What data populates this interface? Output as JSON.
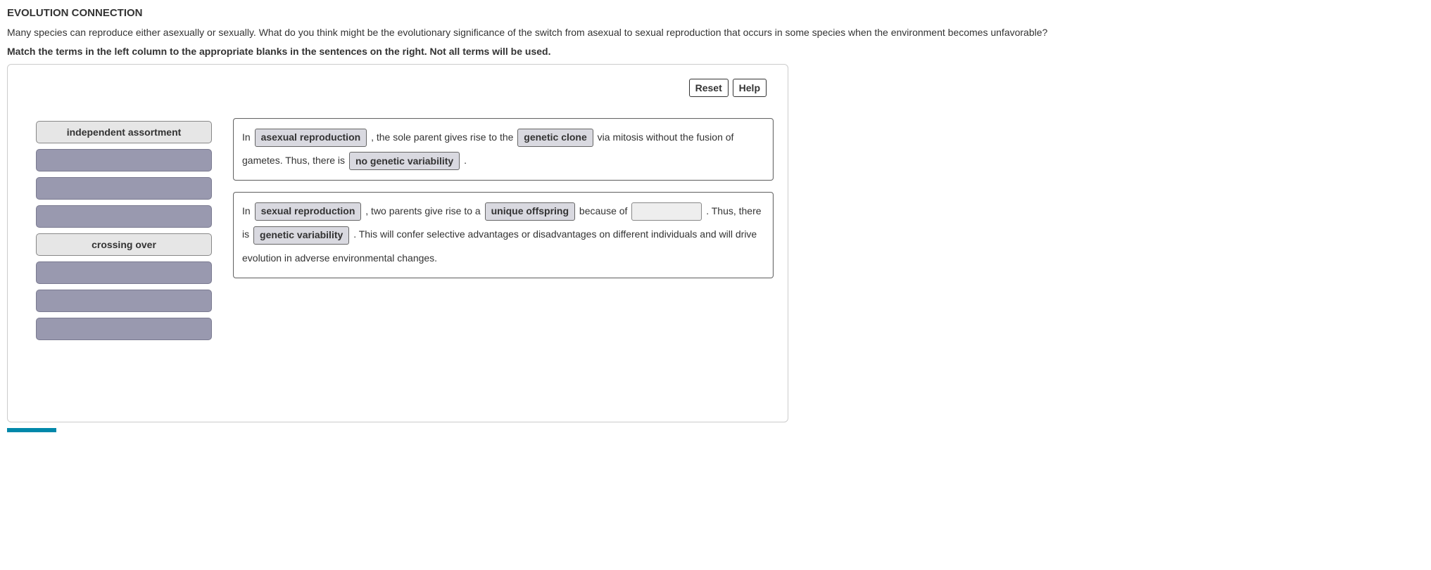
{
  "heading": "EVOLUTION CONNECTION",
  "prompt": "Many species can reproduce either asexually or sexually. What do you think might be the evolutionary significance of the switch from asexual to sexual reproduction that occurs in some species when the environment becomes unfavorable?",
  "instruction": "Match the terms in the left column to the appropriate blanks in the sentences on the right. Not all terms will be used.",
  "controls": {
    "reset": "Reset",
    "help": "Help"
  },
  "terms": [
    {
      "label": "independent assortment",
      "state": "available"
    },
    {
      "label": "",
      "state": "used"
    },
    {
      "label": "",
      "state": "used"
    },
    {
      "label": "",
      "state": "used"
    },
    {
      "label": "crossing over",
      "state": "available"
    },
    {
      "label": "",
      "state": "used"
    },
    {
      "label": "",
      "state": "used"
    },
    {
      "label": "",
      "state": "used"
    }
  ],
  "sentences": {
    "s1": {
      "t1": "In",
      "b1": "asexual reproduction",
      "t2": ", the sole parent gives rise to the",
      "b2": "genetic clone",
      "t3": "via mitosis without the fusion of gametes. Thus, there is",
      "b3": "no genetic variability",
      "t4": "."
    },
    "s2": {
      "t1": "In",
      "b1": "sexual reproduction",
      "t2": ", two parents give rise to a",
      "b2": "unique offspring",
      "t3": "because of",
      "b3": "",
      "t4": ". Thus, there is",
      "b4": "genetic variability",
      "t5": ". This will confer selective advantages or disadvantages on different individuals and will drive evolution in adverse environmental changes."
    }
  }
}
